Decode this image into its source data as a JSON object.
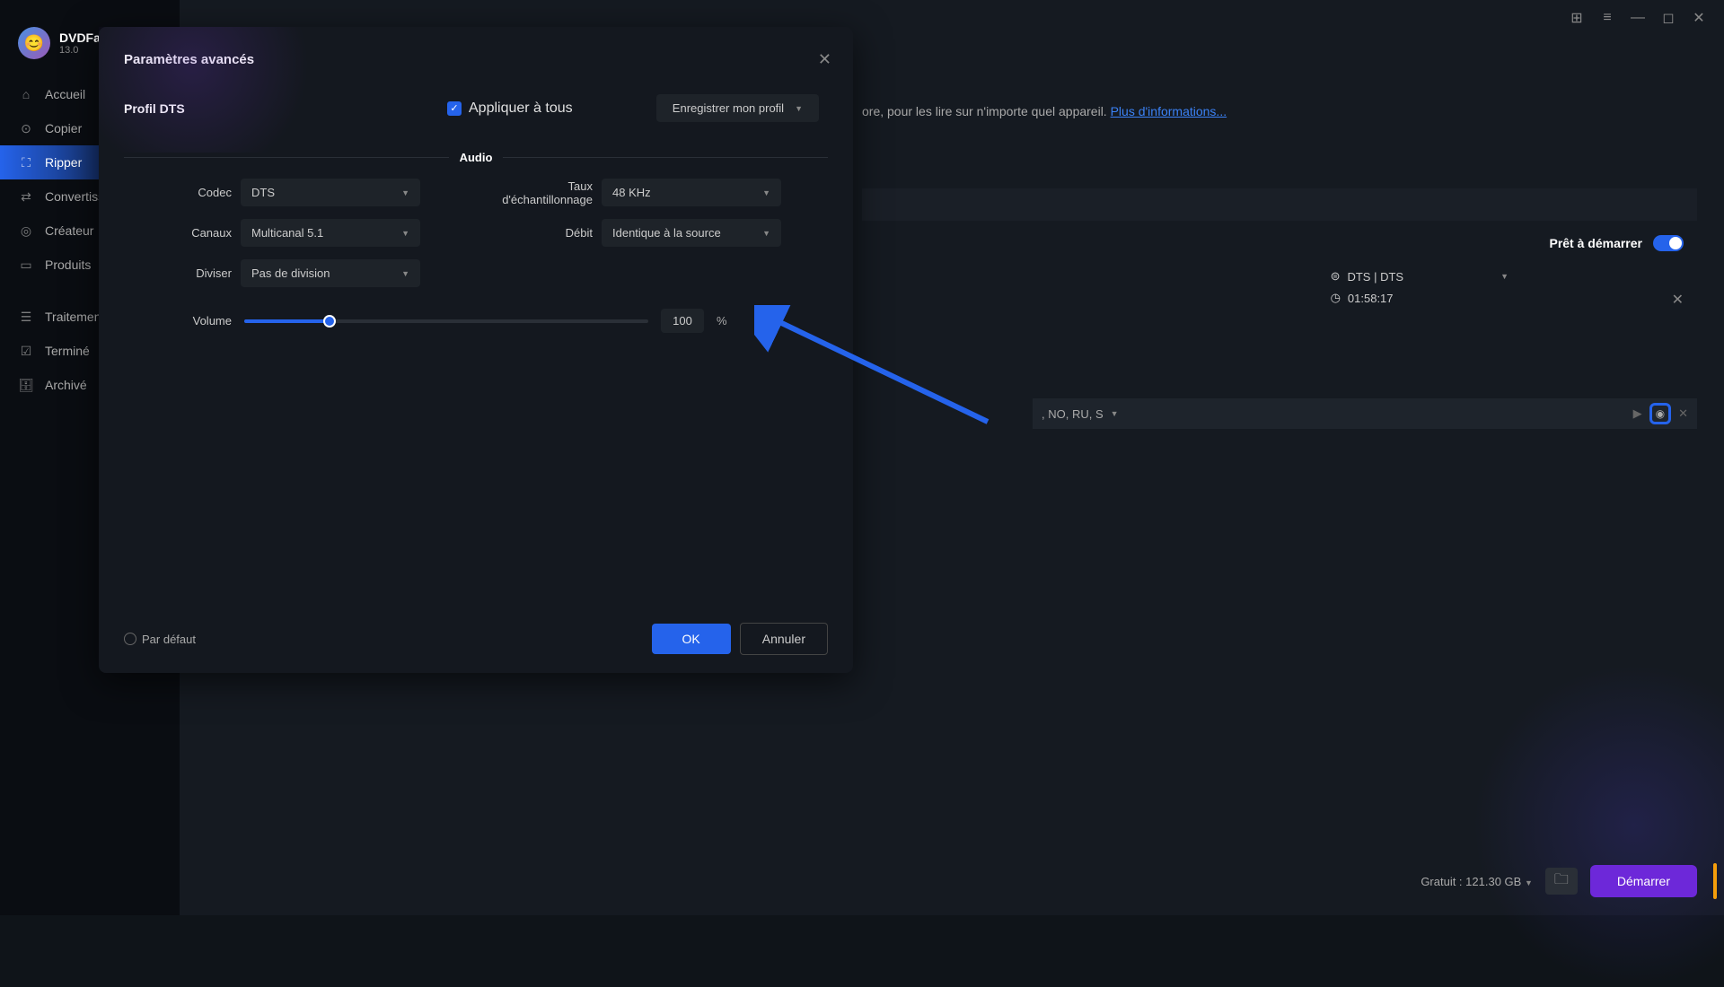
{
  "app": {
    "name": "DVDFab",
    "version": "13.0"
  },
  "sidebar": {
    "items": [
      {
        "label": "Accueil",
        "icon": "home"
      },
      {
        "label": "Copier",
        "icon": "copy-icon"
      },
      {
        "label": "Ripper",
        "icon": "ripper-icon",
        "active": true
      },
      {
        "label": "Convertisseur",
        "icon": "convert-icon"
      },
      {
        "label": "Créateur",
        "icon": "creator-icon"
      },
      {
        "label": "Produits",
        "icon": "products-icon"
      },
      {
        "label": "Traitement",
        "icon": "processing-icon"
      },
      {
        "label": "Terminé",
        "icon": "done-icon"
      },
      {
        "label": "Archivé",
        "icon": "archive-icon"
      }
    ]
  },
  "background": {
    "hint_suffix": "ore, pour les lire sur n'importe quel appareil. ",
    "more_link": "Plus d'informations...",
    "ready_label": "Prêt à démarrer",
    "audio_track": "DTS | DTS",
    "duration": "01:58:17",
    "subtitle_langs": ", NO, RU, S",
    "free_space": "Gratuit : 121.30 GB",
    "start_button": "Démarrer"
  },
  "modal": {
    "title": "Paramètres avancés",
    "profile_label": "Profil DTS",
    "apply_all": "Appliquer à tous",
    "save_profile": "Enregistrer mon profil",
    "section_audio": "Audio",
    "fields": {
      "codec_label": "Codec",
      "codec_value": "DTS",
      "samplerate_label": "Taux d'échantillonnage",
      "samplerate_value": "48 KHz",
      "channels_label": "Canaux",
      "channels_value": "Multicanal 5.1",
      "bitrate_label": "Débit",
      "bitrate_value": "Identique à la source",
      "split_label": "Diviser",
      "split_value": "Pas de division",
      "volume_label": "Volume",
      "volume_value": "100",
      "volume_unit": "%"
    },
    "default_label": "Par défaut",
    "ok": "OK",
    "cancel": "Annuler"
  }
}
